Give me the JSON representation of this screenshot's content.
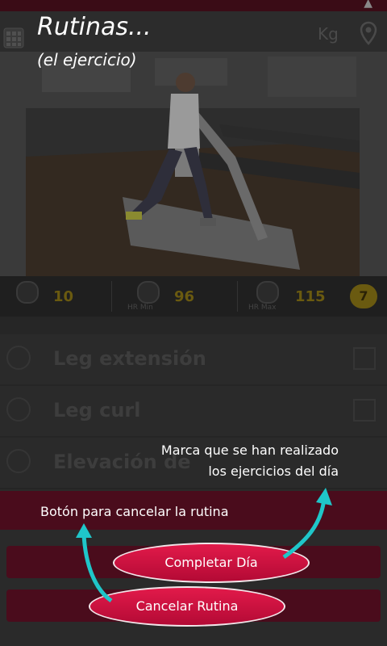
{
  "overlay": {
    "title": "Rutinas...",
    "subtitle": "(el ejercicio)",
    "annotation_mark_line1": "Marca que se han realizado",
    "annotation_mark_line2": "los ejercicios del día",
    "annotation_cancel": "Botón para cancelar la rutina",
    "accent_color": "#e21a4a",
    "arrow_color": "#1fc6c9"
  },
  "header": {
    "unit": "Kg",
    "menu_icon": "grid-icon",
    "location_icon": "pin-icon"
  },
  "stats": {
    "time": "10",
    "hr_min_value": "96",
    "hr_min_label": "HR Min",
    "hr_max_value": "115",
    "hr_max_label": "HR Max",
    "badge": "7"
  },
  "exercises": [
    {
      "label": "Leg extensión"
    },
    {
      "label": "Leg curl"
    },
    {
      "label": "Elevación de"
    }
  ],
  "buttons": {
    "complete": "Completar Día",
    "cancel": "Cancelar Rutina"
  }
}
